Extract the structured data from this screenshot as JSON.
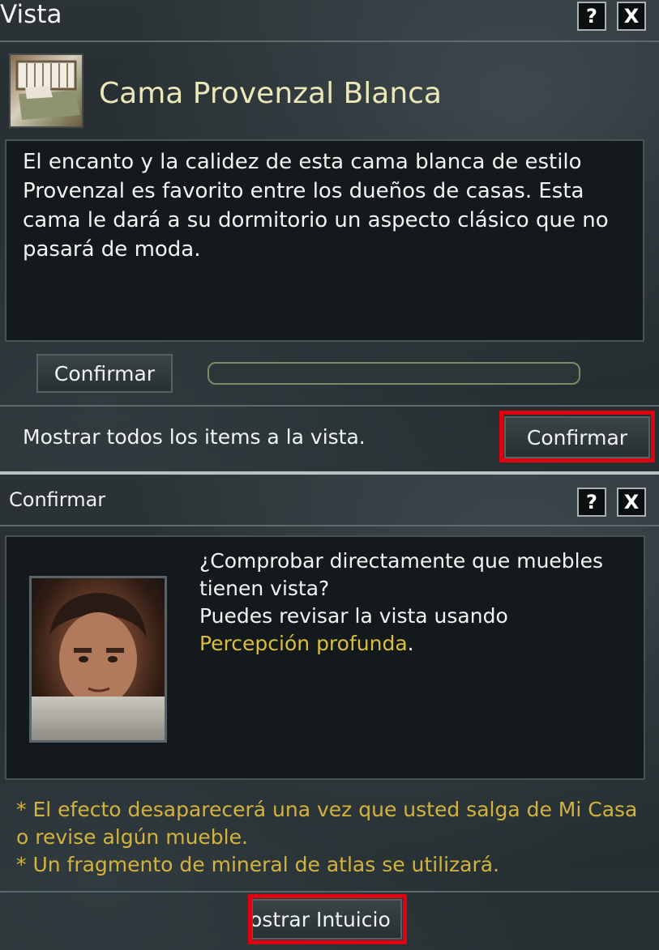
{
  "vista_window": {
    "title": "Vista",
    "help_label": "?",
    "close_label": "X",
    "item": {
      "icon": "bed-icon",
      "name": "Cama Provenzal Blanca",
      "description": "El encanto y la calidez de esta cama blanca de estilo Provenzal es favorito entre los dueños de casas. Esta cama le dará a su dormitorio un aspecto clásico que no pasará de moda."
    },
    "confirm_small_label": "Confirmar",
    "progress_fraction": 0,
    "show_all_text": "Mostrar todos los items a la vista.",
    "confirm_main_label": "Confirmar"
  },
  "confirm_window": {
    "title": "Confirmar",
    "help_label": "?",
    "close_label": "X",
    "npc_portrait": "npc-portrait",
    "message_line1": "¿Comprobar directamente que muebles tienen vista?",
    "message_line2": "Puedes revisar la vista usando",
    "message_link": "Percepción profunda",
    "message_end": ".",
    "notes": [
      "* El efecto desaparecerá una vez que usted salga de Mi Casa o revise algún mueble.",
      "* Un fragmento de mineral de atlas se utilizará."
    ],
    "intuicion_button_label": "ostrar Intuicio"
  },
  "colors": {
    "highlight": "#e0000f",
    "note_text": "#d4b33c",
    "item_title": "#ebe7b8"
  }
}
